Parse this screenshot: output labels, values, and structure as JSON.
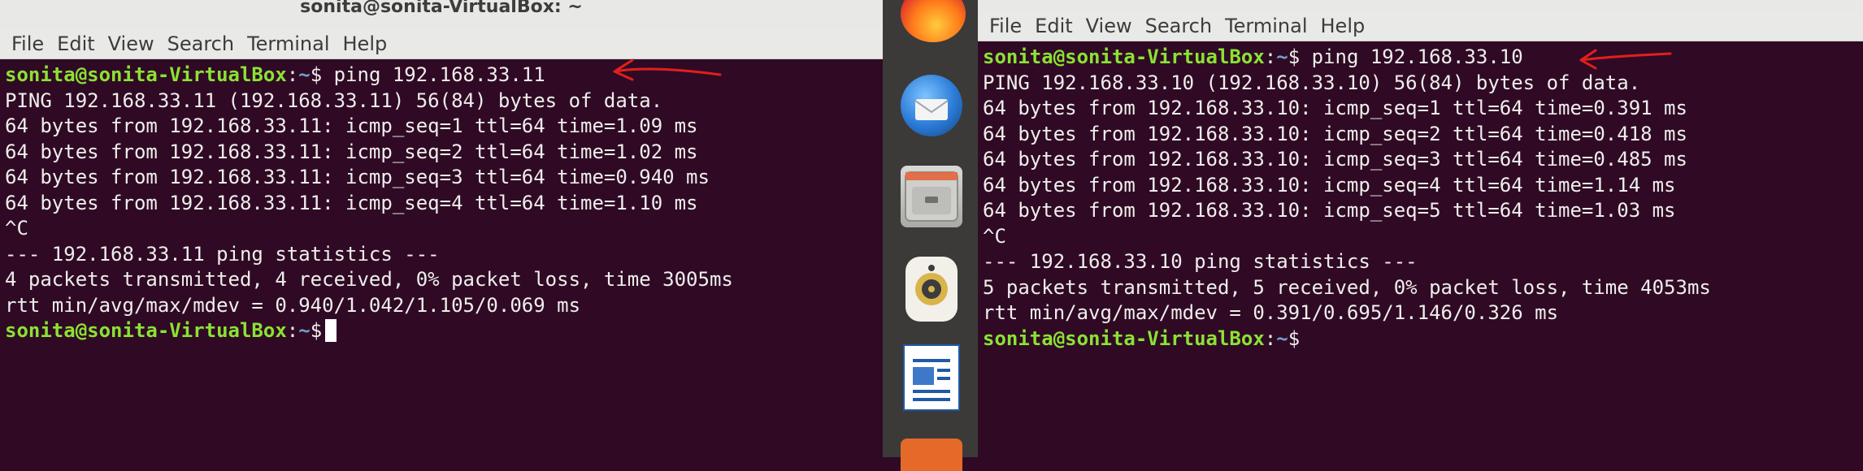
{
  "left_terminal": {
    "title": "sonita@sonita-VirtualBox: ~",
    "menu": [
      "File",
      "Edit",
      "View",
      "Search",
      "Terminal",
      "Help"
    ],
    "prompt_user": "sonita@sonita-VirtualBox",
    "prompt_path": "~",
    "prompt_symbol": "$",
    "command": " ping 192.168.33.11",
    "output": [
      "PING 192.168.33.11 (192.168.33.11) 56(84) bytes of data.",
      "64 bytes from 192.168.33.11: icmp_seq=1 ttl=64 time=1.09 ms",
      "64 bytes from 192.168.33.11: icmp_seq=2 ttl=64 time=1.02 ms",
      "64 bytes from 192.168.33.11: icmp_seq=3 ttl=64 time=0.940 ms",
      "64 bytes from 192.168.33.11: icmp_seq=4 ttl=64 time=1.10 ms",
      "^C",
      "--- 192.168.33.11 ping statistics ---",
      "4 packets transmitted, 4 received, 0% packet loss, time 3005ms",
      "rtt min/avg/max/mdev = 0.940/1.042/1.105/0.069 ms"
    ]
  },
  "right_terminal": {
    "menu": [
      "File",
      "Edit",
      "View",
      "Search",
      "Terminal",
      "Help"
    ],
    "prompt_user": "sonita@sonita-VirtualBox",
    "prompt_path": "~",
    "prompt_symbol": "$",
    "command": " ping 192.168.33.10",
    "output": [
      "PING 192.168.33.10 (192.168.33.10) 56(84) bytes of data.",
      "64 bytes from 192.168.33.10: icmp_seq=1 ttl=64 time=0.391 ms",
      "64 bytes from 192.168.33.10: icmp_seq=2 ttl=64 time=0.418 ms",
      "64 bytes from 192.168.33.10: icmp_seq=3 ttl=64 time=0.485 ms",
      "64 bytes from 192.168.33.10: icmp_seq=4 ttl=64 time=1.14 ms",
      "64 bytes from 192.168.33.10: icmp_seq=5 ttl=64 time=1.03 ms",
      "^C",
      "--- 192.168.33.10 ping statistics ---",
      "5 packets transmitted, 5 received, 0% packet loss, time 4053ms",
      "rtt min/avg/max/mdev = 0.391/0.695/1.146/0.326 ms"
    ]
  },
  "dock": {
    "icons": [
      "firefox-icon",
      "thunderbird-icon",
      "files-icon",
      "rhythmbox-icon",
      "libreoffice-writer-icon",
      "software-icon"
    ]
  },
  "colors": {
    "terminal_bg": "#300a24",
    "prompt_user": "#8ae234",
    "prompt_path": "#729fcf",
    "text": "#eeeeec",
    "annotation_arrow": "#e0201c"
  }
}
